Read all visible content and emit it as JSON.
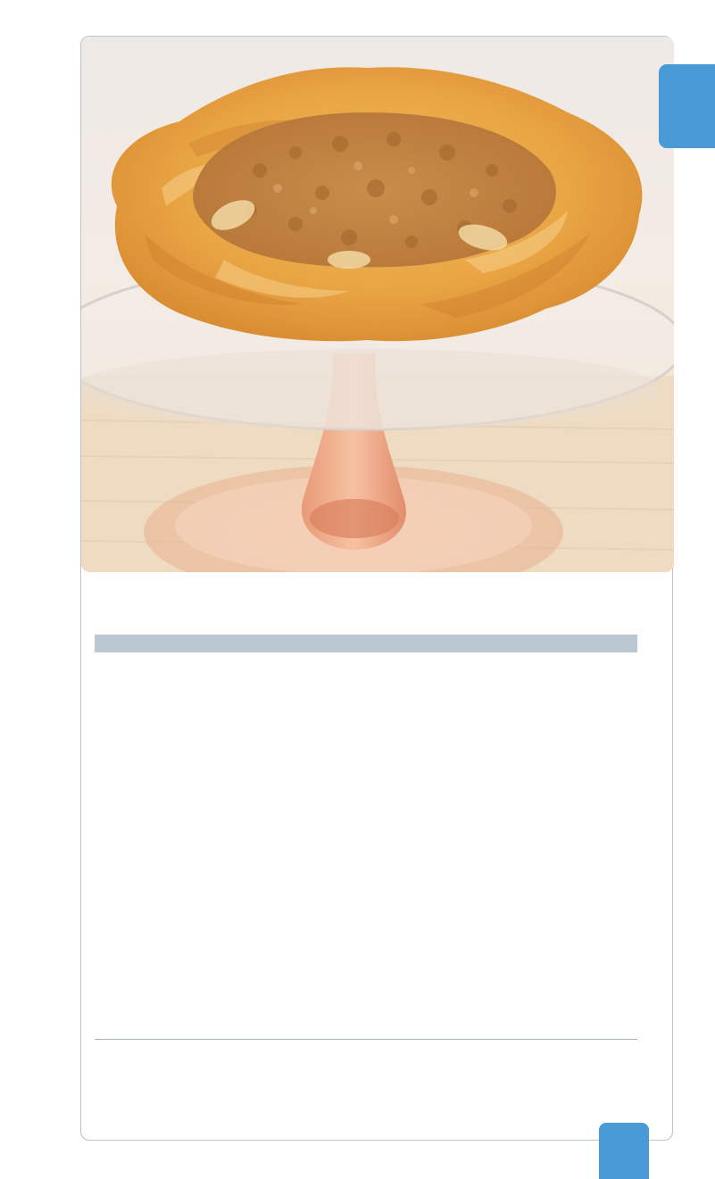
{
  "photo": {
    "subject": "rustic-galette-on-glass-cake-stand"
  },
  "section": {
    "heading": ""
  },
  "footer": {
    "page_number": ""
  },
  "colors": {
    "accent": "#4a9ad6",
    "bar": "#b9c8d1",
    "border": "#b9c4cc"
  }
}
